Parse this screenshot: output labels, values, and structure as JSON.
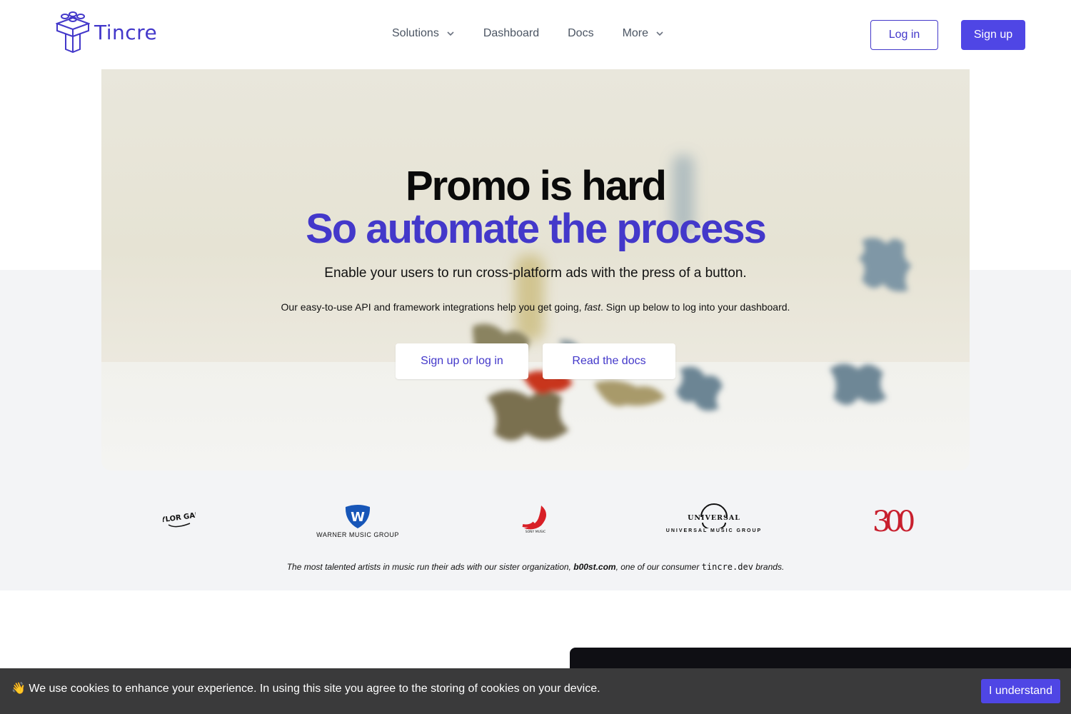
{
  "header": {
    "logo_text": "Tincre",
    "nav": [
      {
        "label": "Solutions",
        "dropdown": true
      },
      {
        "label": "Dashboard",
        "dropdown": false
      },
      {
        "label": "Docs",
        "dropdown": false
      },
      {
        "label": "More",
        "dropdown": true
      }
    ],
    "login_label": "Log in",
    "signup_label": "Sign up"
  },
  "hero": {
    "title_line1": "Promo is hard",
    "title_line2": "So automate the process",
    "subtitle": "Enable your users to run cross-platform ads with the press of a button.",
    "description_pre": "Our easy-to-use API and framework integrations help you get going, ",
    "description_em": "fast",
    "description_post": ". Sign up below to log into your dashboard.",
    "primary_button": "Sign up or log in",
    "secondary_button": "Read the docs"
  },
  "logos": {
    "items": [
      "TAYLOR GANG",
      "WARNER MUSIC GROUP",
      "SONY MUSIC",
      "UNIVERSAL",
      "UNIVERSAL MUSIC GROUP",
      "300"
    ],
    "caption_pre": "The most talented artists in music run their ads with our sister organization, ",
    "caption_bold": "b00st.com",
    "caption_mid": ", one of our consumer ",
    "caption_code": "tincre.dev",
    "caption_post": " brands."
  },
  "cookie": {
    "emoji": "👋",
    "text": "We use cookies to enhance your experience. In using this site you agree to the storing of cookies on your device.",
    "button": "I understand"
  },
  "colors": {
    "brand": "#4338ca",
    "button_bg": "#4f46e5",
    "grey_band": "#f3f4f6",
    "cookie_bg": "#3a3a3b"
  }
}
